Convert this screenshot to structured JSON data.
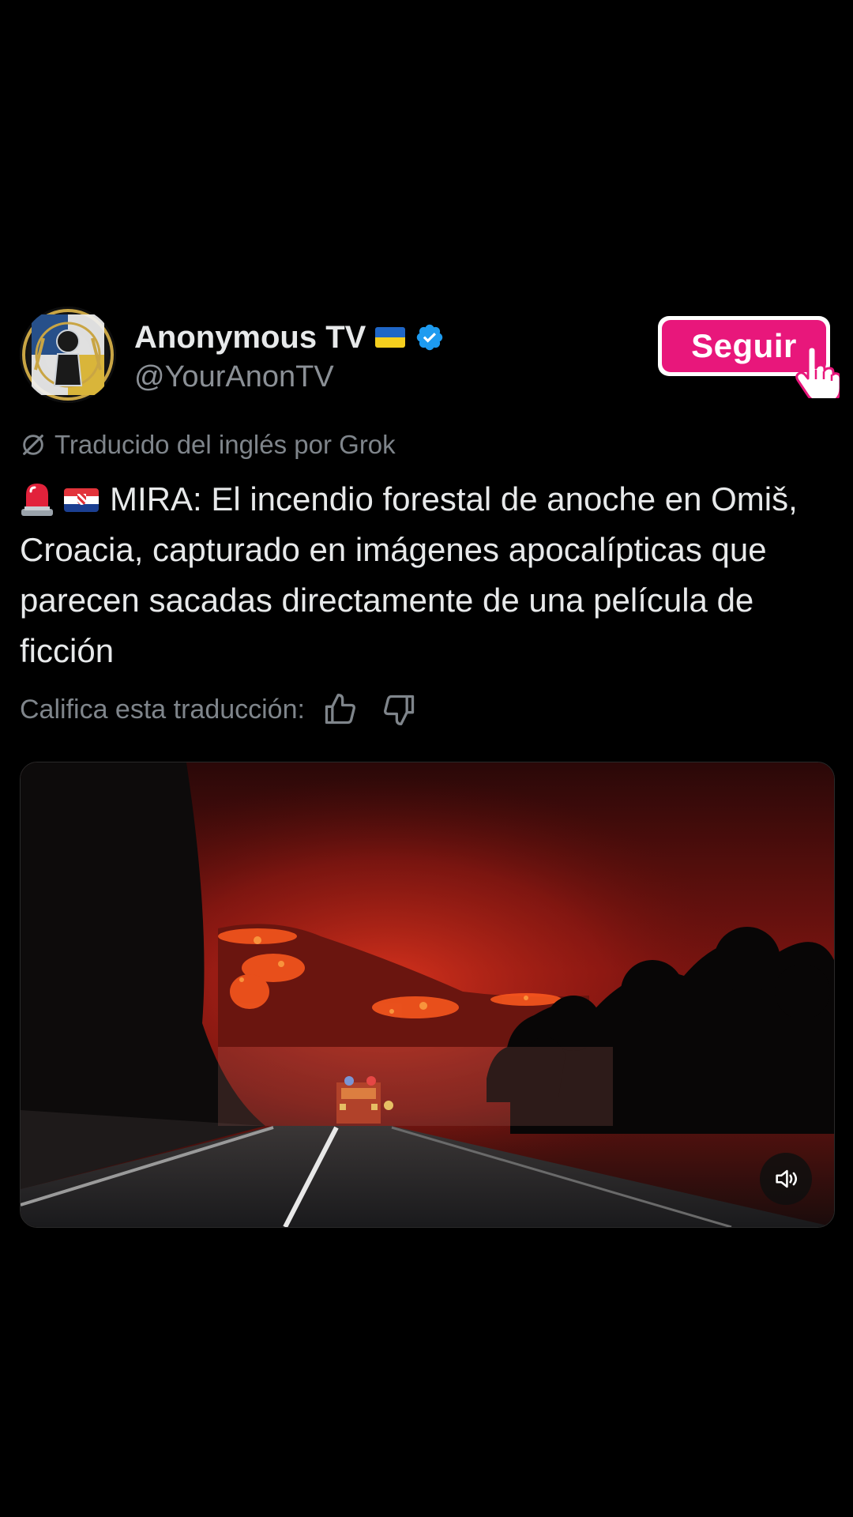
{
  "post": {
    "author": {
      "display_name": "Anonymous TV",
      "handle": "@YourAnonTV",
      "flag_emoji": "ukraine-flag",
      "verified_badge": "verified-check-icon",
      "avatar": "anonymous-emblem-avatar"
    },
    "follow_button": {
      "label": "Seguir",
      "color": "#e8177b"
    },
    "translation_note": "Traducido del inglés por Grok",
    "text": {
      "emojis": [
        "police-siren-emoji",
        "croatia-flag-emoji"
      ],
      "body": "MIRA: El incendio forestal de anoche en Omiš, Croacia, capturado en imágenes apocalípticas que parecen sacadas directamente de una película de ficción"
    },
    "rate_translation": {
      "label": "Califica esta traducción:",
      "like_icon": "thumbs-up-icon",
      "dislike_icon": "thumbs-down-icon"
    },
    "media": {
      "type": "video",
      "description_icon": "wildfire-video-thumbnail",
      "mute_icon": "speaker-icon"
    }
  },
  "colors": {
    "background": "#000000",
    "text_primary": "#e7e9ea",
    "text_secondary": "#7f858b",
    "verified": "#1d9bf0",
    "follow_accent": "#e8177b"
  }
}
